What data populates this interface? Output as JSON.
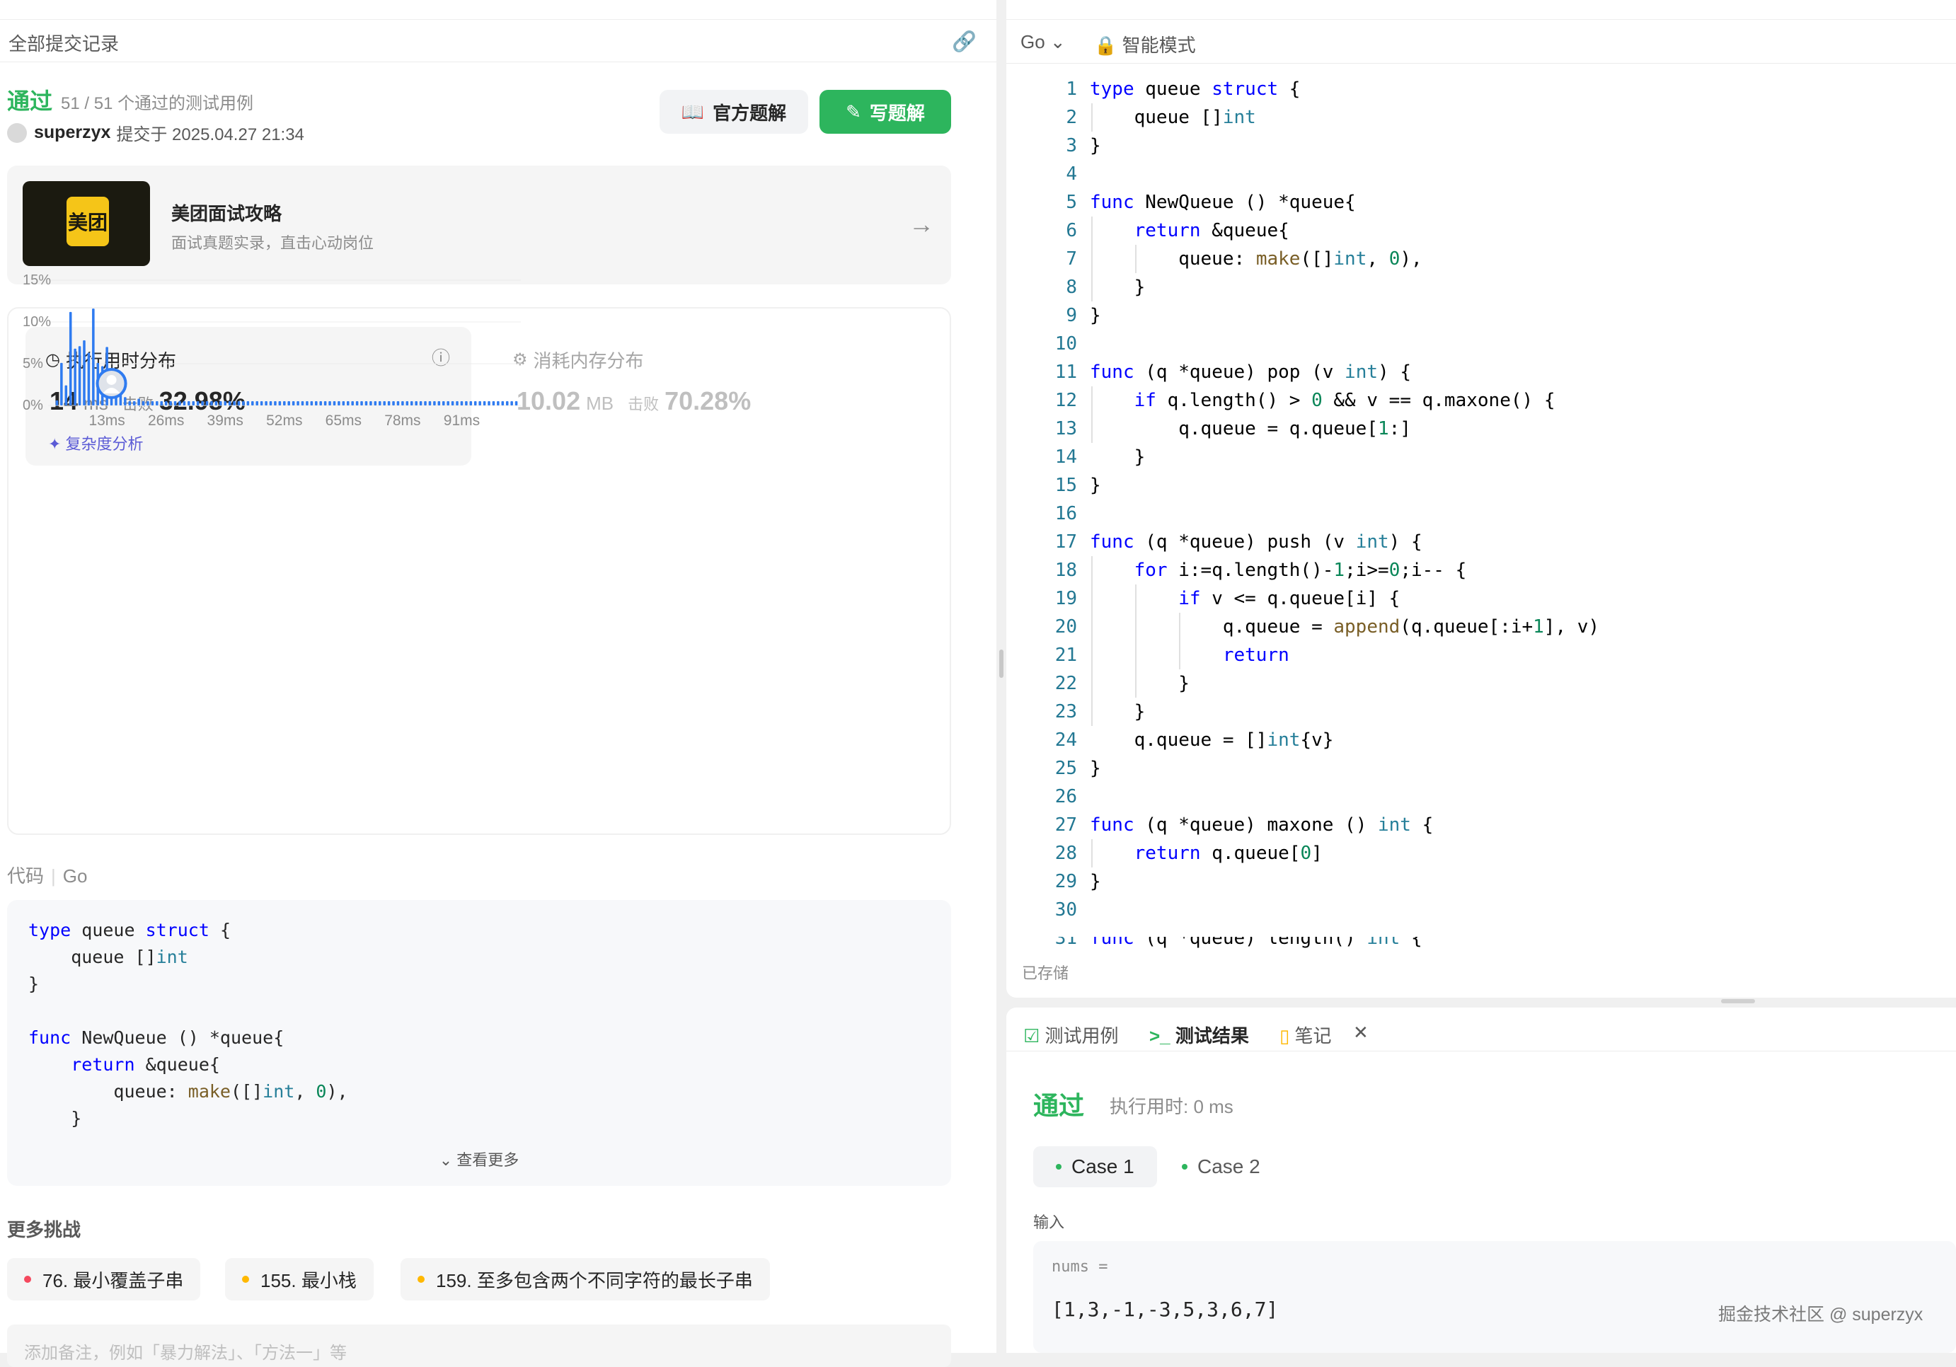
{
  "left": {
    "header_title": "全部提交记录",
    "status": "通过",
    "testcases": "51 / 51 个通过的测试用例",
    "user": "superzyx",
    "submitted_at": "提交于 2025.04.27 21:34",
    "btn_official": "官方题解",
    "btn_write": "写题解",
    "ad_logo": "美团",
    "ad_title": "美团面试攻略",
    "ad_desc": "面试真题实录，直击心动岗位",
    "runtime": {
      "title": "执行用时分布",
      "value": "14",
      "unit": "ms",
      "beat_label": "击败",
      "beat": "32.98%",
      "analysis": "复杂度分析"
    },
    "memory": {
      "title": "消耗内存分布",
      "value": "10.02",
      "unit": "MB",
      "beat_label": "击败",
      "beat": "70.28%"
    },
    "code_label": "代码",
    "code_lang": "Go",
    "code_preview": [
      "type queue struct {",
      "    queue []int",
      "}",
      "",
      "func NewQueue () *queue{",
      "    return &queue{",
      "        queue: make([]int, 0),",
      "    }"
    ],
    "view_more": "查看更多",
    "more_title": "更多挑战",
    "challenges": [
      {
        "label": "76. 最小覆盖子串",
        "color": "#f5495e"
      },
      {
        "label": "155. 最小栈",
        "color": "#ffb800"
      },
      {
        "label": "159. 至多包含两个不同字符的最长子串",
        "color": "#ffb800"
      }
    ],
    "note_placeholder": "添加备注，例如「暴力解法」、「方法一」等"
  },
  "chart_data": {
    "type": "bar",
    "title": "执行用时分布",
    "yticks": [
      "15%",
      "10%",
      "5%",
      "0%"
    ],
    "ylim": [
      0,
      15
    ],
    "xticks": [
      "13ms",
      "26ms",
      "39ms",
      "52ms",
      "65ms",
      "78ms",
      "91ms"
    ],
    "xtick_values": [
      13,
      26,
      39,
      52,
      65,
      78,
      91
    ],
    "xlim": [
      1,
      104
    ],
    "x": [
      2,
      3,
      4,
      5,
      6,
      7,
      8,
      9,
      10,
      11,
      12,
      13,
      14,
      15,
      16,
      17,
      18,
      19,
      20,
      21,
      22,
      23,
      24,
      25,
      26,
      27,
      28,
      29,
      30,
      31,
      32,
      33,
      34,
      35,
      36,
      37,
      38,
      39,
      40,
      41,
      42,
      43,
      44,
      45,
      46,
      47,
      48,
      49,
      50,
      51,
      52,
      53,
      54,
      55,
      56,
      57,
      58,
      59,
      60,
      61,
      62,
      63,
      64,
      65,
      66,
      67,
      68,
      69,
      70,
      71,
      72,
      73,
      74,
      75,
      76,
      77,
      78,
      79,
      80,
      81,
      82,
      83,
      84,
      85,
      86,
      87,
      88,
      89,
      90,
      91,
      92,
      93,
      94,
      95,
      96,
      97,
      98,
      99,
      100,
      101,
      102,
      103
    ],
    "values": [
      0.6,
      5.1,
      2.4,
      11.2,
      6.8,
      7.1,
      7.8,
      6.3,
      11.6,
      5.1,
      4.7,
      7.0,
      2.8,
      2.3,
      2.6,
      1.0,
      0.5,
      0.4,
      0.8,
      0.5,
      0.5,
      0.5,
      0.5,
      0.5,
      0.5,
      0.5,
      0.5,
      0.5,
      0.5,
      0.5,
      0.5,
      0.5,
      0.5,
      0.5,
      0.5,
      0.5,
      0.5,
      0.5,
      0.5,
      0.5,
      0.5,
      0.5,
      0.5,
      0.5,
      0.5,
      0.5,
      0.5,
      0.5,
      0.5,
      0.5,
      0.5,
      0.5,
      0.5,
      0.5,
      0.5,
      0.5,
      0.5,
      0.5,
      0.5,
      0.5,
      0.5,
      0.5,
      0.5,
      0.5,
      0.5,
      0.5,
      0.5,
      0.5,
      0.5,
      0.5,
      0.5,
      0.5,
      0.5,
      0.5,
      0.5,
      0.5,
      0.5,
      0.5,
      0.5,
      0.5,
      0.5,
      0.5,
      0.5,
      0.5,
      0.5,
      0.5,
      0.5,
      0.5,
      0.5,
      0.5,
      0.5,
      0.5,
      0.5,
      0.5,
      0.5,
      0.5,
      0.5,
      0.5,
      0.5,
      0.5,
      0.5,
      0.5
    ],
    "highlight_x": 14,
    "color": "#2f7bf0",
    "grid": true
  },
  "editor": {
    "lang": "Go",
    "mode": "智能模式",
    "saved": "已存储",
    "lines": [
      "type queue struct {",
      "    queue []int",
      "}",
      "",
      "func NewQueue () *queue{",
      "    return &queue{",
      "        queue: make([]int, 0),",
      "    }",
      "}",
      "",
      "func (q *queue) pop (v int) {",
      "    if q.length() > 0 && v == q.maxone() {",
      "        q.queue = q.queue[1:]",
      "    }",
      "}",
      "",
      "func (q *queue) push (v int) {",
      "    for i:=q.length()-1;i>=0;i-- {",
      "        if v <= q.queue[i] {",
      "            q.queue = append(q.queue[:i+1], v)",
      "            return",
      "        }",
      "    }",
      "    q.queue = []int{v}",
      "}",
      "",
      "func (q *queue) maxone () int {",
      "    return q.queue[0]",
      "}",
      "",
      "func (q *queue) length() int {"
    ]
  },
  "console": {
    "tab_cases": "测试用例",
    "tab_result": "测试结果",
    "tab_notes": "笔记",
    "status": "通过",
    "time": "执行用时: 0 ms",
    "case1": "Case 1",
    "case2": "Case 2",
    "input_label": "输入",
    "input_key": "nums =",
    "input_value": "[1,3,-1,-3,5,3,6,7]"
  },
  "watermark": "掘金技术社区 @ superzyx"
}
